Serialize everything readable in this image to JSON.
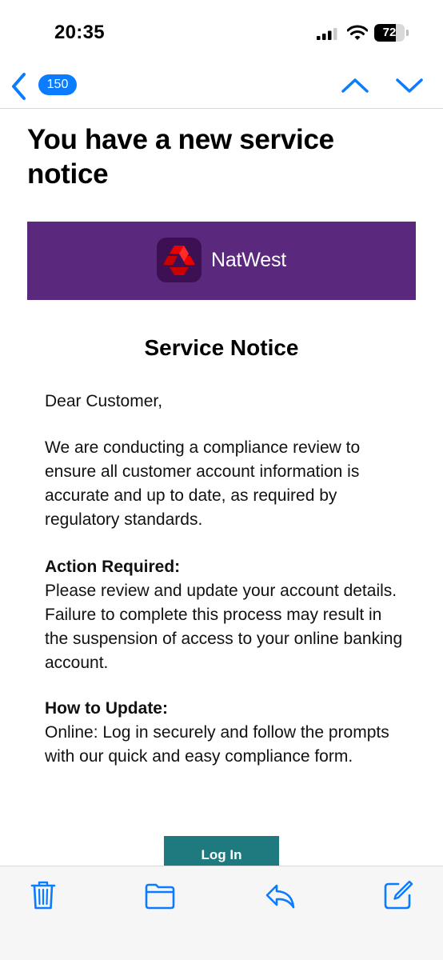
{
  "status_bar": {
    "time": "20:35",
    "battery": "72",
    "battery_level": 0.72
  },
  "nav": {
    "back_count": "150"
  },
  "email": {
    "subject": "You have a new service notice",
    "brand_name": "NatWest",
    "notice_title": "Service Notice",
    "greeting": "Dear Customer,",
    "paragraph1": "We are conducting a compliance review to ensure all customer account information is accurate and up to date, as required by regulatory standards.",
    "action_heading": "Action Required:",
    "action_text": "Please review and update your account details. Failure to complete this process may result in the suspension of access to your online banking account.",
    "howto_heading": "How to Update:",
    "howto_text": "Online: Log in securely and follow the prompts with our quick and easy compliance form.",
    "login_button": "Log In"
  },
  "colors": {
    "accent_blue": "#0a7cff",
    "banner_purple": "#5a287d",
    "logo_red": "#e90000",
    "button_teal": "#1e7a7f"
  },
  "icons": [
    "signal-icon",
    "wifi-icon",
    "battery-icon",
    "back-chevron-icon",
    "up-chevron-icon",
    "down-chevron-icon",
    "natwest-logo-icon",
    "trash-icon",
    "folder-icon",
    "reply-icon",
    "compose-icon"
  ]
}
